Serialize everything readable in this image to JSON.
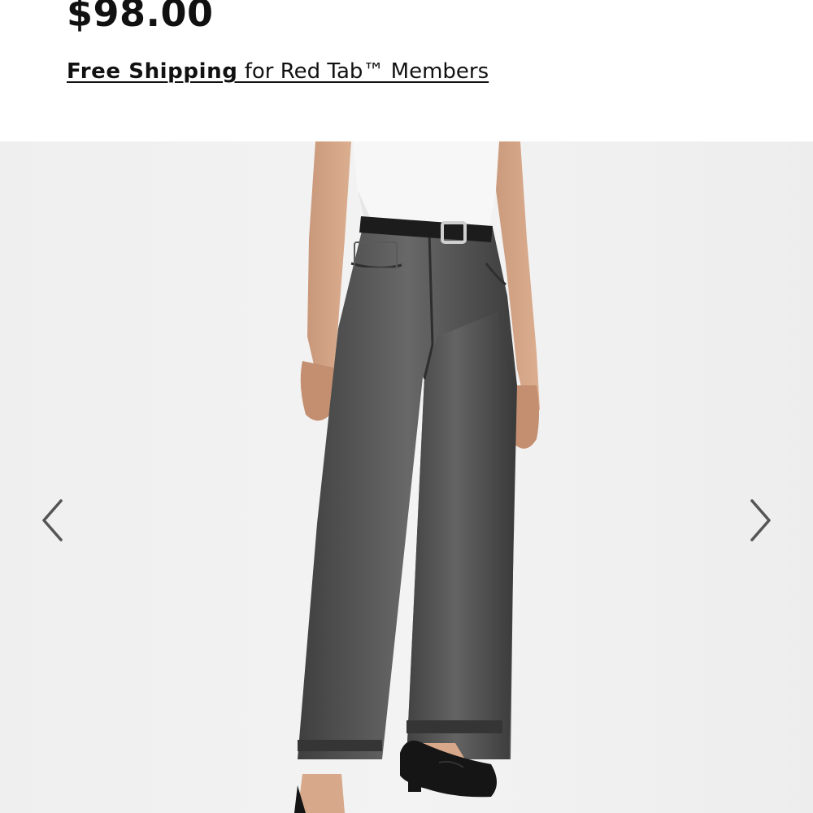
{
  "product": {
    "price": "$98.00"
  },
  "shipping": {
    "bold_text": "Free Shipping",
    "rest_text": " for Red Tab™ Members"
  },
  "gallery": {
    "prev_icon": "chevron-left-icon",
    "next_icon": "chevron-right-icon",
    "image_subject": "model wearing grey wide-leg jeans with black belt and black flats"
  },
  "colors": {
    "text": "#111111",
    "gallery_background": "#eeeeee",
    "denim": "#4f4f4f",
    "arrow": "#555555"
  }
}
